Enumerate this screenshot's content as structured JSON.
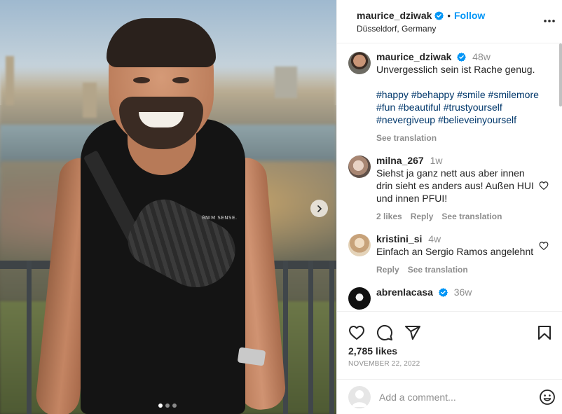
{
  "post": {
    "author": "maurice_dziwak",
    "follow_label": "Follow",
    "bullet": "•",
    "location": "Düsseldorf, Germany",
    "shirt_text": "ϑΝΙΜ SENSE.",
    "carousel": {
      "total": 3,
      "active_index": 0
    }
  },
  "caption": {
    "user": "maurice_dziwak",
    "time": "48w",
    "text": "Unvergesslich sein ist Rache genug.",
    "hashtags": "#happy #behappy #smile #smilemore #fun #beautiful #trustyourself #nevergiveup #believeinyourself",
    "see_translation": "See translation"
  },
  "comments": [
    {
      "user": "milna_267",
      "time": "1w",
      "text": "Siehst ja ganz nett aus aber innen drin sieht es anders aus! Außen HUI und innen PFUI!",
      "likes": "2 likes",
      "reply": "Reply",
      "see_translation": "See translation"
    },
    {
      "user": "kristini_si",
      "time": "4w",
      "text": "Einfach an Sergio Ramos angelehnt",
      "reply": "Reply",
      "see_translation": "See translation"
    },
    {
      "user": "abrenlacasa",
      "time": "36w"
    }
  ],
  "footer": {
    "likes": "2,785 likes",
    "date": "NOVEMBER 22, 2022",
    "comment_placeholder": "Add a comment..."
  },
  "icons": {
    "verified": "verified-badge-icon",
    "more": "more-options-icon",
    "like": "heart-icon",
    "comment": "comment-icon",
    "share": "share-icon",
    "save": "bookmark-icon",
    "emoji": "emoji-icon",
    "next": "chevron-right-icon"
  },
  "colors": {
    "accent": "#0095f6",
    "text": "#262626",
    "muted": "#8e8e8e",
    "hashtag": "#00376b"
  }
}
